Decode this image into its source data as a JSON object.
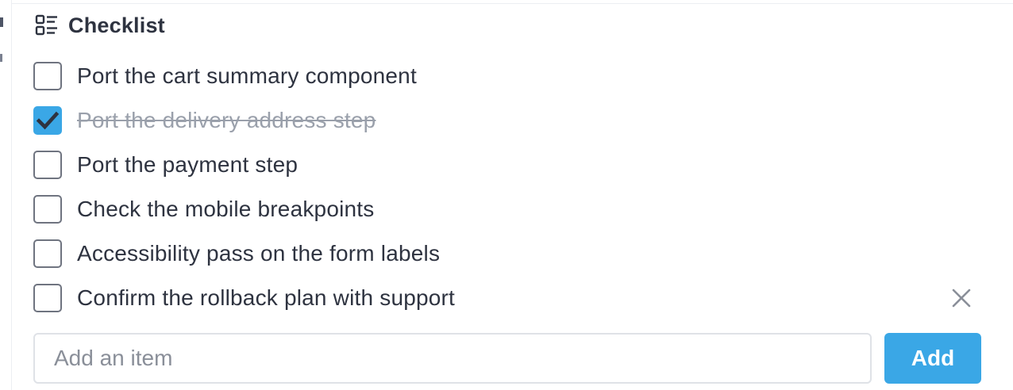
{
  "checklist": {
    "title": "Checklist",
    "icon": "checklist-icon",
    "items": [
      {
        "label": "Port the cart summary component",
        "checked": false
      },
      {
        "label": "Port the delivery address step",
        "checked": true
      },
      {
        "label": "Port the payment step",
        "checked": false
      },
      {
        "label": "Check the mobile breakpoints",
        "checked": false
      },
      {
        "label": "Accessibility pass on the form labels",
        "checked": false
      },
      {
        "label": "Confirm the rollback plan with support",
        "checked": false
      }
    ],
    "remove_icon": "close-icon"
  },
  "add_item": {
    "placeholder": "Add an item",
    "value": "",
    "button_label": "Add"
  },
  "colors": {
    "accent": "#3aa7e6",
    "text": "#2e3340",
    "done_text": "#9aa0ab",
    "checkbox_border": "#6f7480"
  }
}
